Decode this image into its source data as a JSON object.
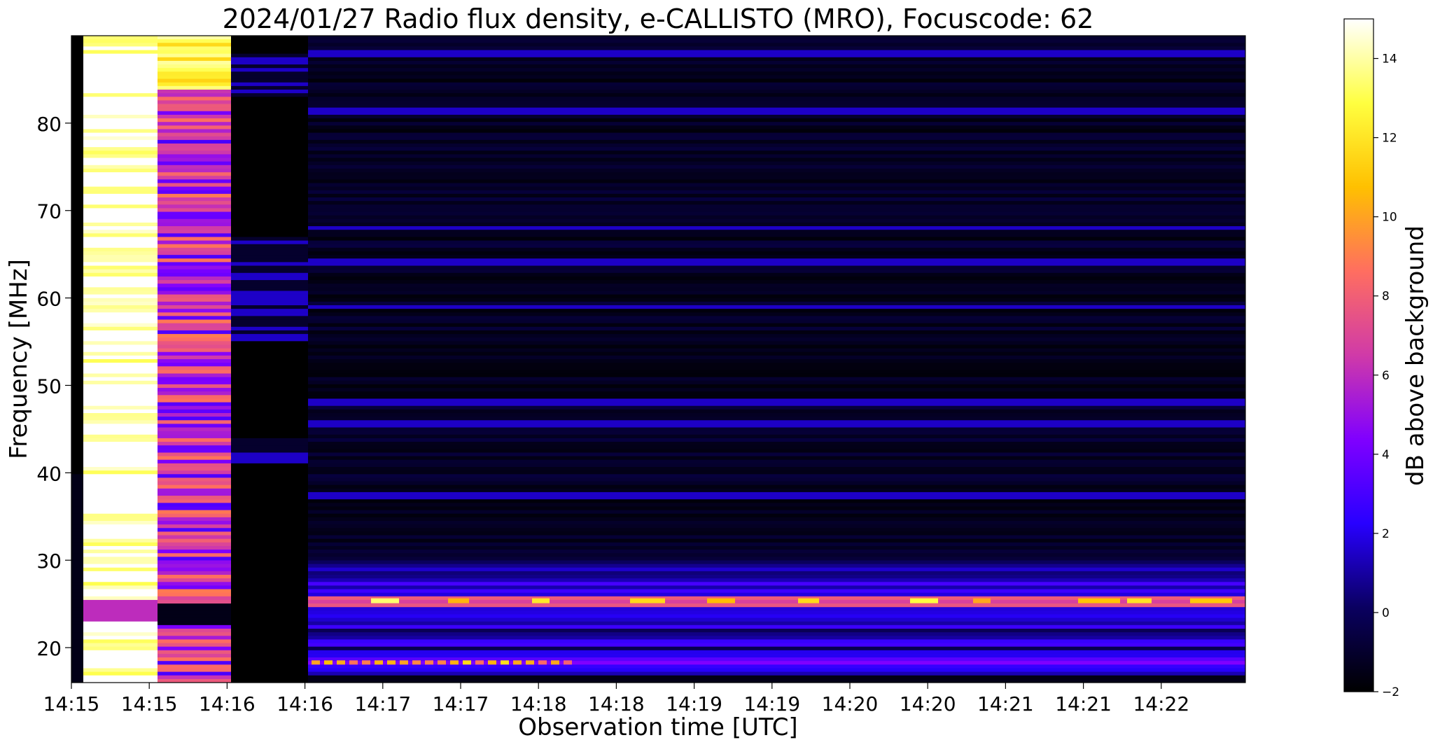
{
  "chart_data": {
    "type": "heatmap",
    "title": "2024/01/27  Radio flux density, e-CALLISTO (MRO), Focuscode: 62",
    "xlabel": "Observation time [UTC]",
    "ylabel": "Frequency [MHz]",
    "x_ticks": [
      "14:15",
      "14:15",
      "14:16",
      "14:16",
      "14:17",
      "14:17",
      "14:18",
      "14:18",
      "14:19",
      "14:19",
      "14:20",
      "14:20",
      "14:21",
      "14:21",
      "14:22"
    ],
    "y_ticks": [
      20,
      30,
      40,
      50,
      60,
      70,
      80
    ],
    "ylim": [
      16,
      90
    ],
    "colorbar": {
      "label": "dB above background",
      "ticks": [
        -2,
        0,
        2,
        4,
        6,
        8,
        10,
        12,
        14
      ],
      "range": [
        -2,
        15
      ],
      "colormap": "gnuplot2"
    },
    "features": [
      {
        "description_time": "14:15 start",
        "segment": 1,
        "level_db": -2
      },
      {
        "segment": 2,
        "level_db": 14
      },
      {
        "segment": 3,
        "level_db": 7
      },
      {
        "segment": 4,
        "level_db": -1
      },
      {
        "segment": 5,
        "level_db": -1
      }
    ],
    "band_levels_db": {
      "background": -1.5,
      "interference_lines": 0,
      "low_band_18_30MHz": 3,
      "hot_25MHz": 10
    }
  },
  "colors": {
    "cmap_stops": [
      "#000000",
      "#0a0060",
      "#2800ff",
      "#8000ff",
      "#d03aa8",
      "#ff6e60",
      "#ffc000",
      "#ffff40",
      "#ffffff"
    ]
  }
}
